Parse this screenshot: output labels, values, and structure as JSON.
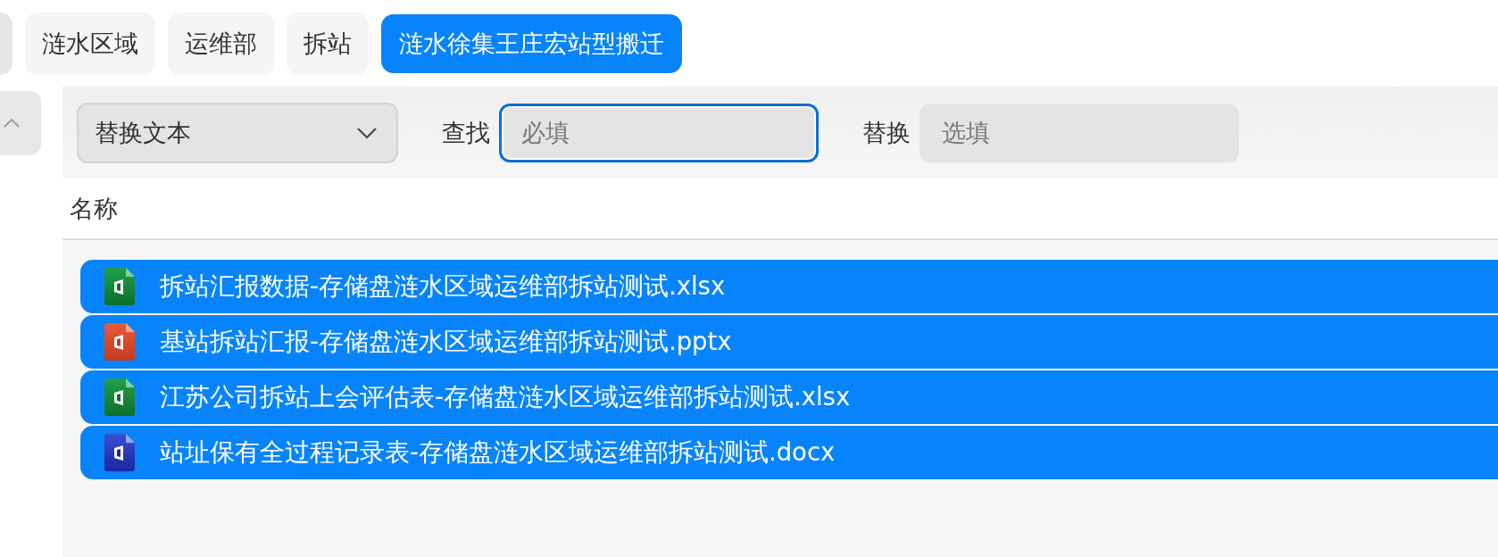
{
  "breadcrumbs": [
    {
      "label": "涟水区域",
      "selected": false
    },
    {
      "label": "运维部",
      "selected": false
    },
    {
      "label": "拆站",
      "selected": false
    },
    {
      "label": "涟水徐集王庄宏站型搬迁",
      "selected": true
    }
  ],
  "toolbar": {
    "mode_dropdown": {
      "value": "替换文本"
    },
    "find": {
      "label": "查找",
      "placeholder": "必填",
      "focused": true
    },
    "replace": {
      "label": "替换",
      "placeholder": "选填",
      "focused": false
    }
  },
  "table": {
    "columns": [
      "名称"
    ],
    "rows": [
      {
        "name": "拆站汇报数据-存储盘涟水区域运维部拆站测试.xlsx",
        "kind": "spreadsheet",
        "selected": true
      },
      {
        "name": "基站拆站汇报-存储盘涟水区域运维部拆站测试.pptx",
        "kind": "presentation",
        "selected": true
      },
      {
        "name": "江苏公司拆站上会评估表-存储盘涟水区域运维部拆站测试.xlsx",
        "kind": "spreadsheet",
        "selected": true
      },
      {
        "name": "站址保有全过程记录表-存储盘涟水区域运维部拆站测试.docx",
        "kind": "document",
        "selected": true
      }
    ]
  }
}
